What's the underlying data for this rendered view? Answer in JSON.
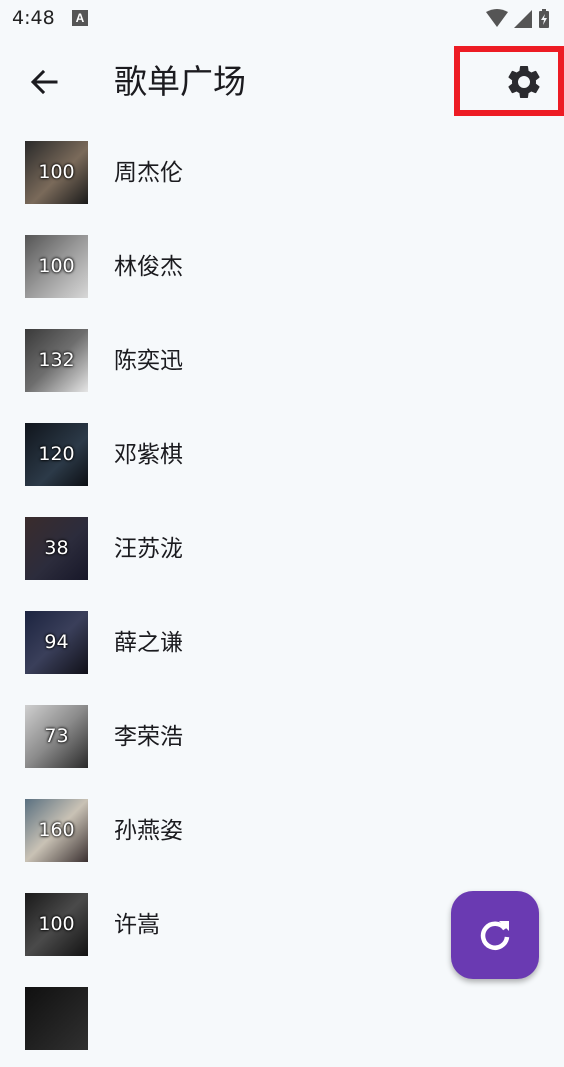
{
  "status_bar": {
    "time": "4:48",
    "notification": "A"
  },
  "app_bar": {
    "title": "歌单广场"
  },
  "playlists": [
    {
      "name": "周杰伦",
      "count": "100"
    },
    {
      "name": "林俊杰",
      "count": "100"
    },
    {
      "name": "陈奕迅",
      "count": "132"
    },
    {
      "name": "邓紫棋",
      "count": "120"
    },
    {
      "name": "汪苏泷",
      "count": "38"
    },
    {
      "name": "薛之谦",
      "count": "94"
    },
    {
      "name": "李荣浩",
      "count": "73"
    },
    {
      "name": "孙燕姿",
      "count": "160"
    },
    {
      "name": "许嵩",
      "count": "100"
    }
  ],
  "icons": {
    "back": "arrow-left-icon",
    "settings": "gear-icon",
    "refresh": "refresh-icon"
  },
  "colors": {
    "background": "#f6f9fb",
    "fab": "#6a3ab2",
    "highlight_border": "#ed1c24"
  }
}
